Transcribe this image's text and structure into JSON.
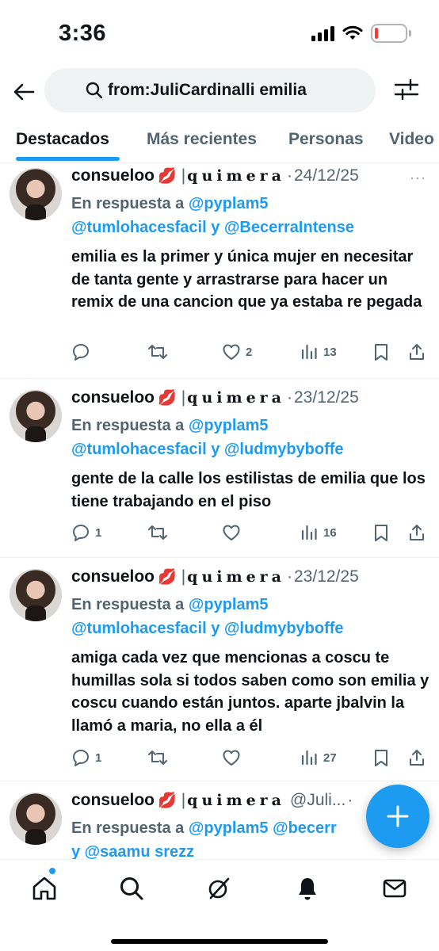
{
  "status_bar": {
    "time": "3:36",
    "battery_level": 0.12
  },
  "header": {
    "search_query": "from:JuliCardinalli emilia"
  },
  "tabs": [
    {
      "label": "Destacados",
      "active": true
    },
    {
      "label": "Más recientes",
      "active": false
    },
    {
      "label": "Personas",
      "active": false
    },
    {
      "label": "Video",
      "active": false
    }
  ],
  "tweets": [
    {
      "name": "consueloo",
      "emoji": "💋",
      "separator": "|",
      "handle_styled": "quimera",
      "dot": "·",
      "date": "24/12/25",
      "reply_prefix": "En respuesta a",
      "mention_1": "@pyplam5",
      "mention_2": "@tumlohacesfacil",
      "reply_join": "y",
      "mention_3": "@BecerraIntense",
      "text": "emilia es la primer y única mujer en necesitar de tanta gente y arrastrarse para hacer un remix de una cancion que ya estaba re pegada",
      "replies": "",
      "retweets": "",
      "likes": "2",
      "views": "13"
    },
    {
      "name": "consueloo",
      "emoji": "💋",
      "separator": "|",
      "handle_styled": "quimera",
      "dot": "·",
      "date": "23/12/25",
      "reply_prefix": "En respuesta a",
      "mention_1": "@pyplam5",
      "mention_2": "@tumlohacesfacil",
      "reply_join": "y",
      "mention_3": "@ludmybyboffe",
      "text": "gente de la calle los estilistas de emilia que los tiene trabajando en el piso",
      "replies": "1",
      "retweets": "",
      "likes": "",
      "views": "16"
    },
    {
      "name": "consueloo",
      "emoji": "💋",
      "separator": "|",
      "handle_styled": "quimera",
      "dot": "·",
      "date": "23/12/25",
      "reply_prefix": "En respuesta a",
      "mention_1": "@pyplam5",
      "mention_2": "@tumlohacesfacil",
      "reply_join": "y",
      "mention_3": "@ludmybyboffe",
      "text": "amiga cada vez que mencionas a coscu te humillas sola si todos saben como son emilia y coscu cuando están juntos. aparte jbalvin la llamó a maria, no ella a él",
      "replies": "1",
      "retweets": "",
      "likes": "",
      "views": "27"
    },
    {
      "name": "consueloo",
      "emoji": "💋",
      "separator": "|",
      "handle_styled": "quimera",
      "handle_suffix": "@Juli...",
      "dot": "·",
      "reply_prefix": "En respuesta a",
      "mention_1": "@pyplam5",
      "mention_2": "@becerr",
      "mention_3": "y @saamu srezz"
    }
  ],
  "icons": {
    "back": "arrow-left-icon",
    "search": "search-icon",
    "filter": "sliders-icon",
    "reply": "comment-icon",
    "retweet": "retweet-icon",
    "like": "heart-icon",
    "views": "bar-chart-icon",
    "bookmark": "bookmark-icon",
    "share": "share-icon",
    "compose": "plus-icon",
    "nav": [
      "home-icon",
      "search-icon",
      "grok-icon",
      "bell-icon",
      "mail-icon"
    ]
  },
  "colors": {
    "accent": "#1d9bf0",
    "text": "#0f1419",
    "muted": "#536471",
    "battery_low": "#ff3b30"
  }
}
